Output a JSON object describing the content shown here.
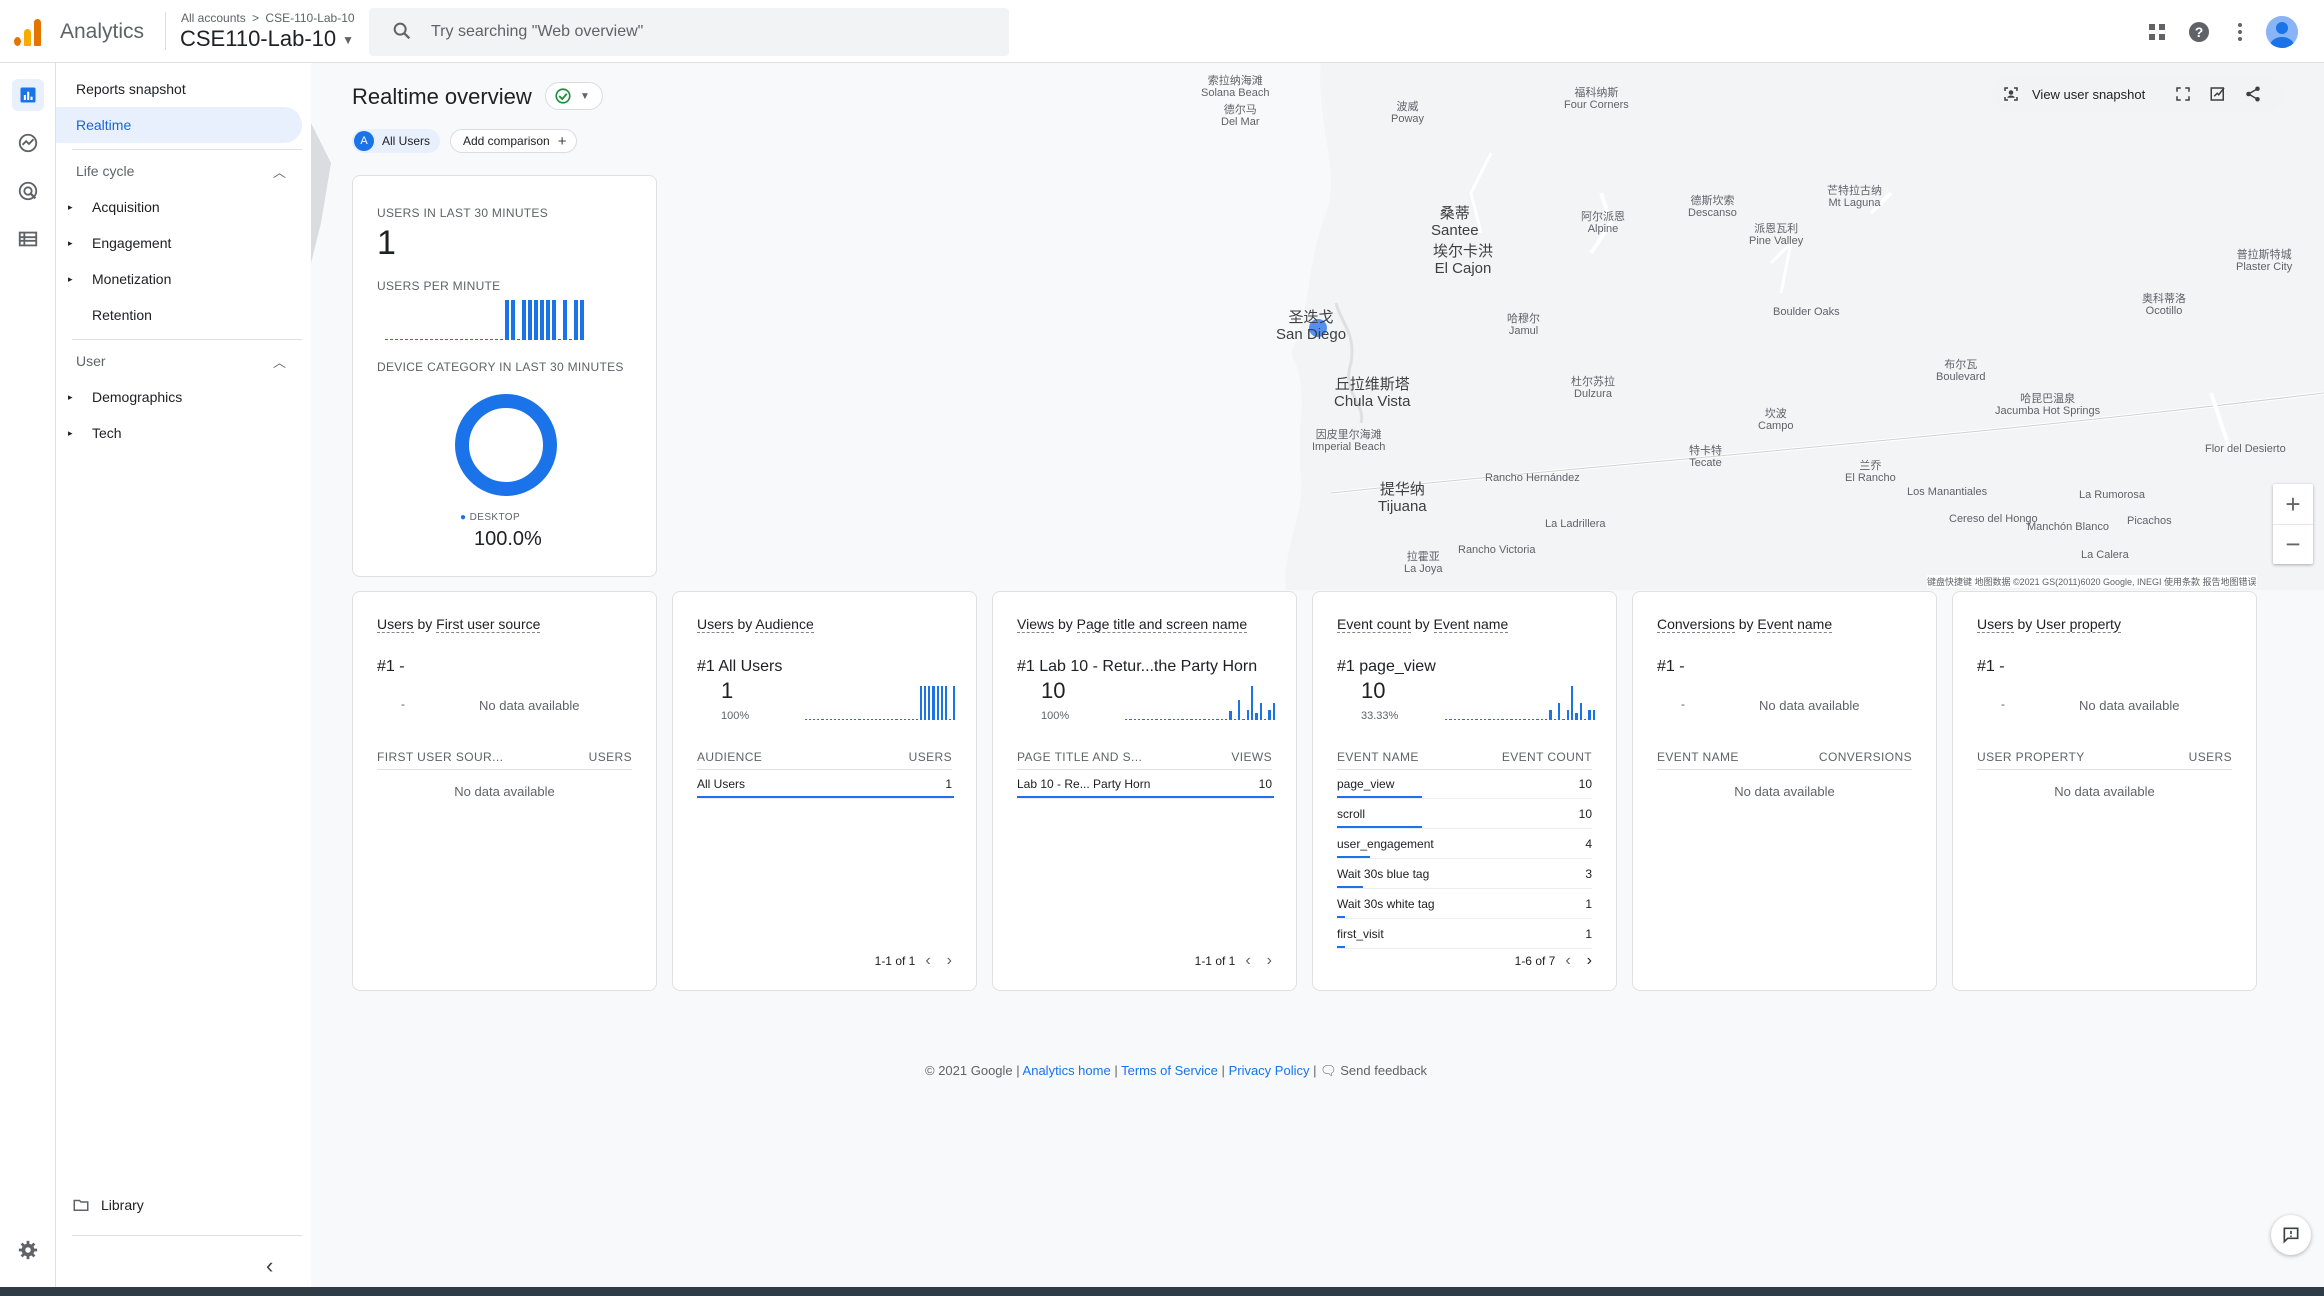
{
  "header": {
    "app_name": "Analytics",
    "breadcrumb_all": "All accounts",
    "breadcrumb_sep": ">",
    "breadcrumb_account": "CSE-110-Lab-10",
    "property_name": "CSE110-Lab-10",
    "search_placeholder": "Try searching \"Web overview\"",
    "brand_colors": [
      "#f9ab00",
      "#e37400"
    ]
  },
  "nav": {
    "reports_snapshot": "Reports snapshot",
    "realtime": "Realtime",
    "life_cycle": "Life cycle",
    "acquisition": "Acquisition",
    "engagement": "Engagement",
    "monetization": "Monetization",
    "retention": "Retention",
    "user": "User",
    "demographics": "Demographics",
    "tech": "Tech",
    "library": "Library"
  },
  "realtime": {
    "title": "Realtime overview",
    "segment_badge": "A",
    "segment_label": "All Users",
    "add_comparison": "Add comparison",
    "view_user_snapshot": "View user snapshot"
  },
  "map": {
    "labels": [
      {
        "zh": "索拉纳海滩",
        "en": "Solana Beach"
      },
      {
        "zh": "德尔马",
        "en": "Del Mar"
      },
      {
        "zh": "波威",
        "en": "Poway"
      },
      {
        "zh": "福科纳斯",
        "en": "Four Corners"
      },
      {
        "zh": "桑蒂",
        "en": "Santee"
      },
      {
        "zh": "埃尔卡洪",
        "en": "El Cajon"
      },
      {
        "zh": "阿尔派恩",
        "en": "Alpine"
      },
      {
        "zh": "德斯坎索",
        "en": "Descanso"
      },
      {
        "zh": "芒特拉古纳",
        "en": "Mt Laguna"
      },
      {
        "zh": "派恩瓦利",
        "en": "Pine Valley"
      },
      {
        "zh": "圣迭戈",
        "en": "San Diego"
      },
      {
        "zh": "哈穆尔",
        "en": "Jamul"
      },
      {
        "zh": "",
        "en": "Boulder Oaks"
      },
      {
        "zh": "奥科蒂洛",
        "en": "Ocotillo"
      },
      {
        "zh": "普拉斯特城",
        "en": "Plaster City"
      },
      {
        "zh": "丘拉维斯塔",
        "en": "Chula Vista"
      },
      {
        "zh": "杜尔苏拉",
        "en": "Dulzura"
      },
      {
        "zh": "布尔瓦",
        "en": "Boulevard"
      },
      {
        "zh": "哈昆巴温泉",
        "en": "Jacumba Hot Springs"
      },
      {
        "zh": "因皮里尔海滩",
        "en": "Imperial Beach"
      },
      {
        "zh": "坎波",
        "en": "Campo"
      },
      {
        "zh": "特卡特",
        "en": "Tecate"
      },
      {
        "zh": "兰乔",
        "en": "El Rancho"
      },
      {
        "zh": "",
        "en": "Flor del Desierto"
      },
      {
        "zh": "提华纳",
        "en": "Tijuana"
      },
      {
        "zh": "",
        "en": "Rancho Hernández"
      },
      {
        "zh": "",
        "en": "Los Manantiales"
      },
      {
        "zh": "",
        "en": "La Rumorosa"
      },
      {
        "zh": "",
        "en": "La Ladrillera"
      },
      {
        "zh": "",
        "en": "Cereso del Hongo"
      },
      {
        "zh": "",
        "en": "Manchón Blanco"
      },
      {
        "zh": "",
        "en": "Picachos"
      },
      {
        "zh": "拉霍亚",
        "en": "La Joya"
      },
      {
        "zh": "",
        "en": "Rancho Victoria"
      },
      {
        "zh": "",
        "en": "La Calera"
      }
    ],
    "footer": "键盘快捷键   地图数据 ©2021 GS(2011)6020 Google, INEGI   使用条款   报告地图错误",
    "zoom_in": "+",
    "zoom_out": "−"
  },
  "summary_card": {
    "users_30_label": "USERS IN LAST 30 MINUTES",
    "users_30_value": "1",
    "users_per_minute_label": "USERS PER MINUTE",
    "device_label": "DEVICE CATEGORY IN LAST 30 MINUTES",
    "device_name": "DESKTOP",
    "device_pct": "100.0%",
    "users_per_minute": [
      0,
      0,
      0,
      0,
      0,
      0,
      0,
      0,
      0,
      0,
      0,
      0,
      0,
      0,
      0,
      0,
      0,
      0,
      0,
      0,
      0,
      0,
      0,
      0,
      1,
      1,
      0,
      1,
      1,
      1,
      1,
      1,
      1,
      0,
      1,
      0,
      1,
      1
    ]
  },
  "cards": [
    {
      "title_a": "Users",
      "title_b": "by",
      "title_c": "First user source",
      "rank": "#1  -",
      "nodata": "No data available",
      "dash": "-",
      "col1": "FIRST USER SOUR...",
      "col2": "USERS",
      "body_nodata": "No data available"
    },
    {
      "title_a": "Users",
      "title_b": "by",
      "title_c": "Audience",
      "rank": "#1  All Users",
      "value": "1",
      "pct": "100%",
      "col1": "AUDIENCE",
      "col2": "USERS",
      "rows": [
        {
          "name": "All Users",
          "value": "1",
          "bar": 1.0
        }
      ],
      "pager": "1-1 of 1",
      "spark": [
        0,
        0,
        0,
        0,
        0,
        0,
        0,
        0,
        0,
        0,
        0,
        0,
        0,
        0,
        0,
        0,
        0,
        0,
        0,
        0,
        0,
        0,
        0,
        0,
        0,
        0,
        0,
        0,
        1,
        1,
        1,
        1,
        1,
        1,
        1,
        0,
        1
      ]
    },
    {
      "title_a": "Views",
      "title_b": "by",
      "title_c": "Page title and screen name",
      "rank": "#1  Lab 10 - Retur...the Party Horn",
      "value": "10",
      "pct": "100%",
      "col1": "PAGE TITLE AND S...",
      "col2": "VIEWS",
      "rows": [
        {
          "name": "Lab 10 - Re... Party Horn",
          "value": "10",
          "bar": 1.0
        }
      ],
      "pager": "1-1 of 1",
      "spark": [
        0,
        0,
        0,
        0,
        0,
        0,
        0,
        0,
        0,
        0,
        0,
        0,
        0,
        0,
        0,
        0,
        0,
        0,
        0,
        0,
        0,
        0,
        0,
        0,
        0.25,
        0,
        0.6,
        0,
        0.3,
        1,
        0.2,
        0.5,
        0,
        0.3,
        0.5
      ]
    },
    {
      "title_a": "Event count",
      "title_b": "by",
      "title_c": "Event name",
      "rank": "#1  page_view",
      "value": "10",
      "pct": "33.33%",
      "col1": "EVENT NAME",
      "col2": "EVENT COUNT",
      "rows": [
        {
          "name": "page_view",
          "value": "10",
          "bar": 0.33
        },
        {
          "name": "scroll",
          "value": "10",
          "bar": 0.33
        },
        {
          "name": "user_engagement",
          "value": "4",
          "bar": 0.13
        },
        {
          "name": "Wait 30s blue tag",
          "value": "3",
          "bar": 0.1
        },
        {
          "name": "Wait 30s white tag",
          "value": "1",
          "bar": 0.03
        },
        {
          "name": "first_visit",
          "value": "1",
          "bar": 0.03
        }
      ],
      "pager": "1-6 of 7",
      "spark": [
        0,
        0,
        0,
        0,
        0,
        0,
        0,
        0,
        0,
        0,
        0,
        0,
        0,
        0,
        0,
        0,
        0,
        0,
        0,
        0,
        0,
        0,
        0,
        0,
        0.3,
        0,
        0.5,
        0,
        0.3,
        1,
        0.2,
        0.5,
        0,
        0.3,
        0.3
      ]
    },
    {
      "title_a": "Conversions",
      "title_b": "by",
      "title_c": "Event name",
      "rank": "#1  -",
      "nodata": "No data available",
      "dash": "-",
      "col1": "EVENT NAME",
      "col2": "CONVERSIONS",
      "body_nodata": "No data available"
    },
    {
      "title_a": "Users",
      "title_b": "by",
      "title_c": "User property",
      "rank": "#1  -",
      "nodata": "No data available",
      "dash": "-",
      "col1": "USER PROPERTY",
      "col2": "USERS",
      "body_nodata": "No data available"
    }
  ],
  "footer": {
    "copyright": "© 2021 Google |",
    "analytics_home": "Analytics home",
    "sep1": "|",
    "terms": "Terms of Service",
    "sep2": "|",
    "privacy": "Privacy Policy",
    "sep3": "|",
    "feedback": "Send feedback"
  }
}
